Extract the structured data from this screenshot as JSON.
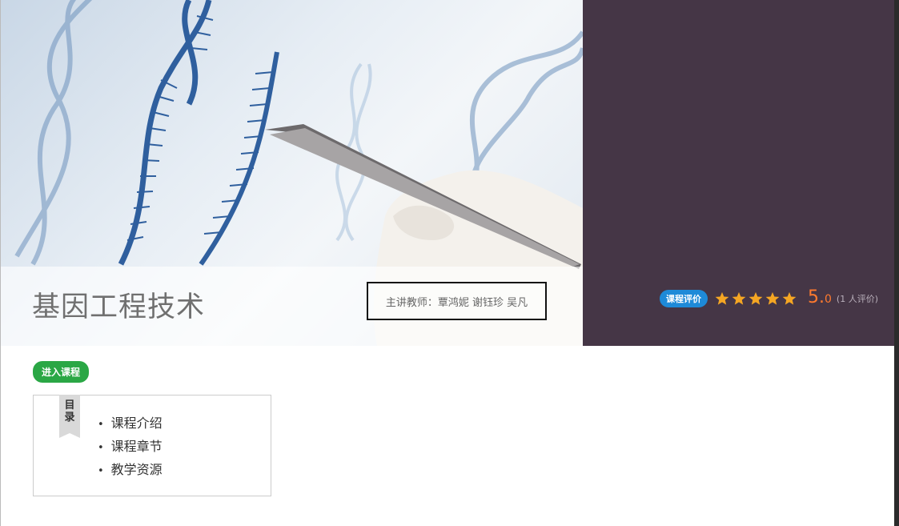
{
  "course": {
    "title": "基因工程技术",
    "teacher_label": "主讲教师：覃鸿妮 谢钰珍 吴凡"
  },
  "rating": {
    "badge_label": "课程评价",
    "stars": 5,
    "score": "5.",
    "score_decimal": "0",
    "count_text": "(1 人评价)",
    "star_color": "#f5a623",
    "score_color": "#ff7a2e"
  },
  "actions": {
    "enter_label": "进入课程"
  },
  "toc": {
    "ribbon_label": "目录",
    "items": [
      {
        "label": "课程介绍"
      },
      {
        "label": "课程章节"
      },
      {
        "label": "教学资源"
      }
    ]
  },
  "colors": {
    "banner_bg": "#453646",
    "badge_blue": "#1e8ad8",
    "enter_green": "#2aa745"
  }
}
